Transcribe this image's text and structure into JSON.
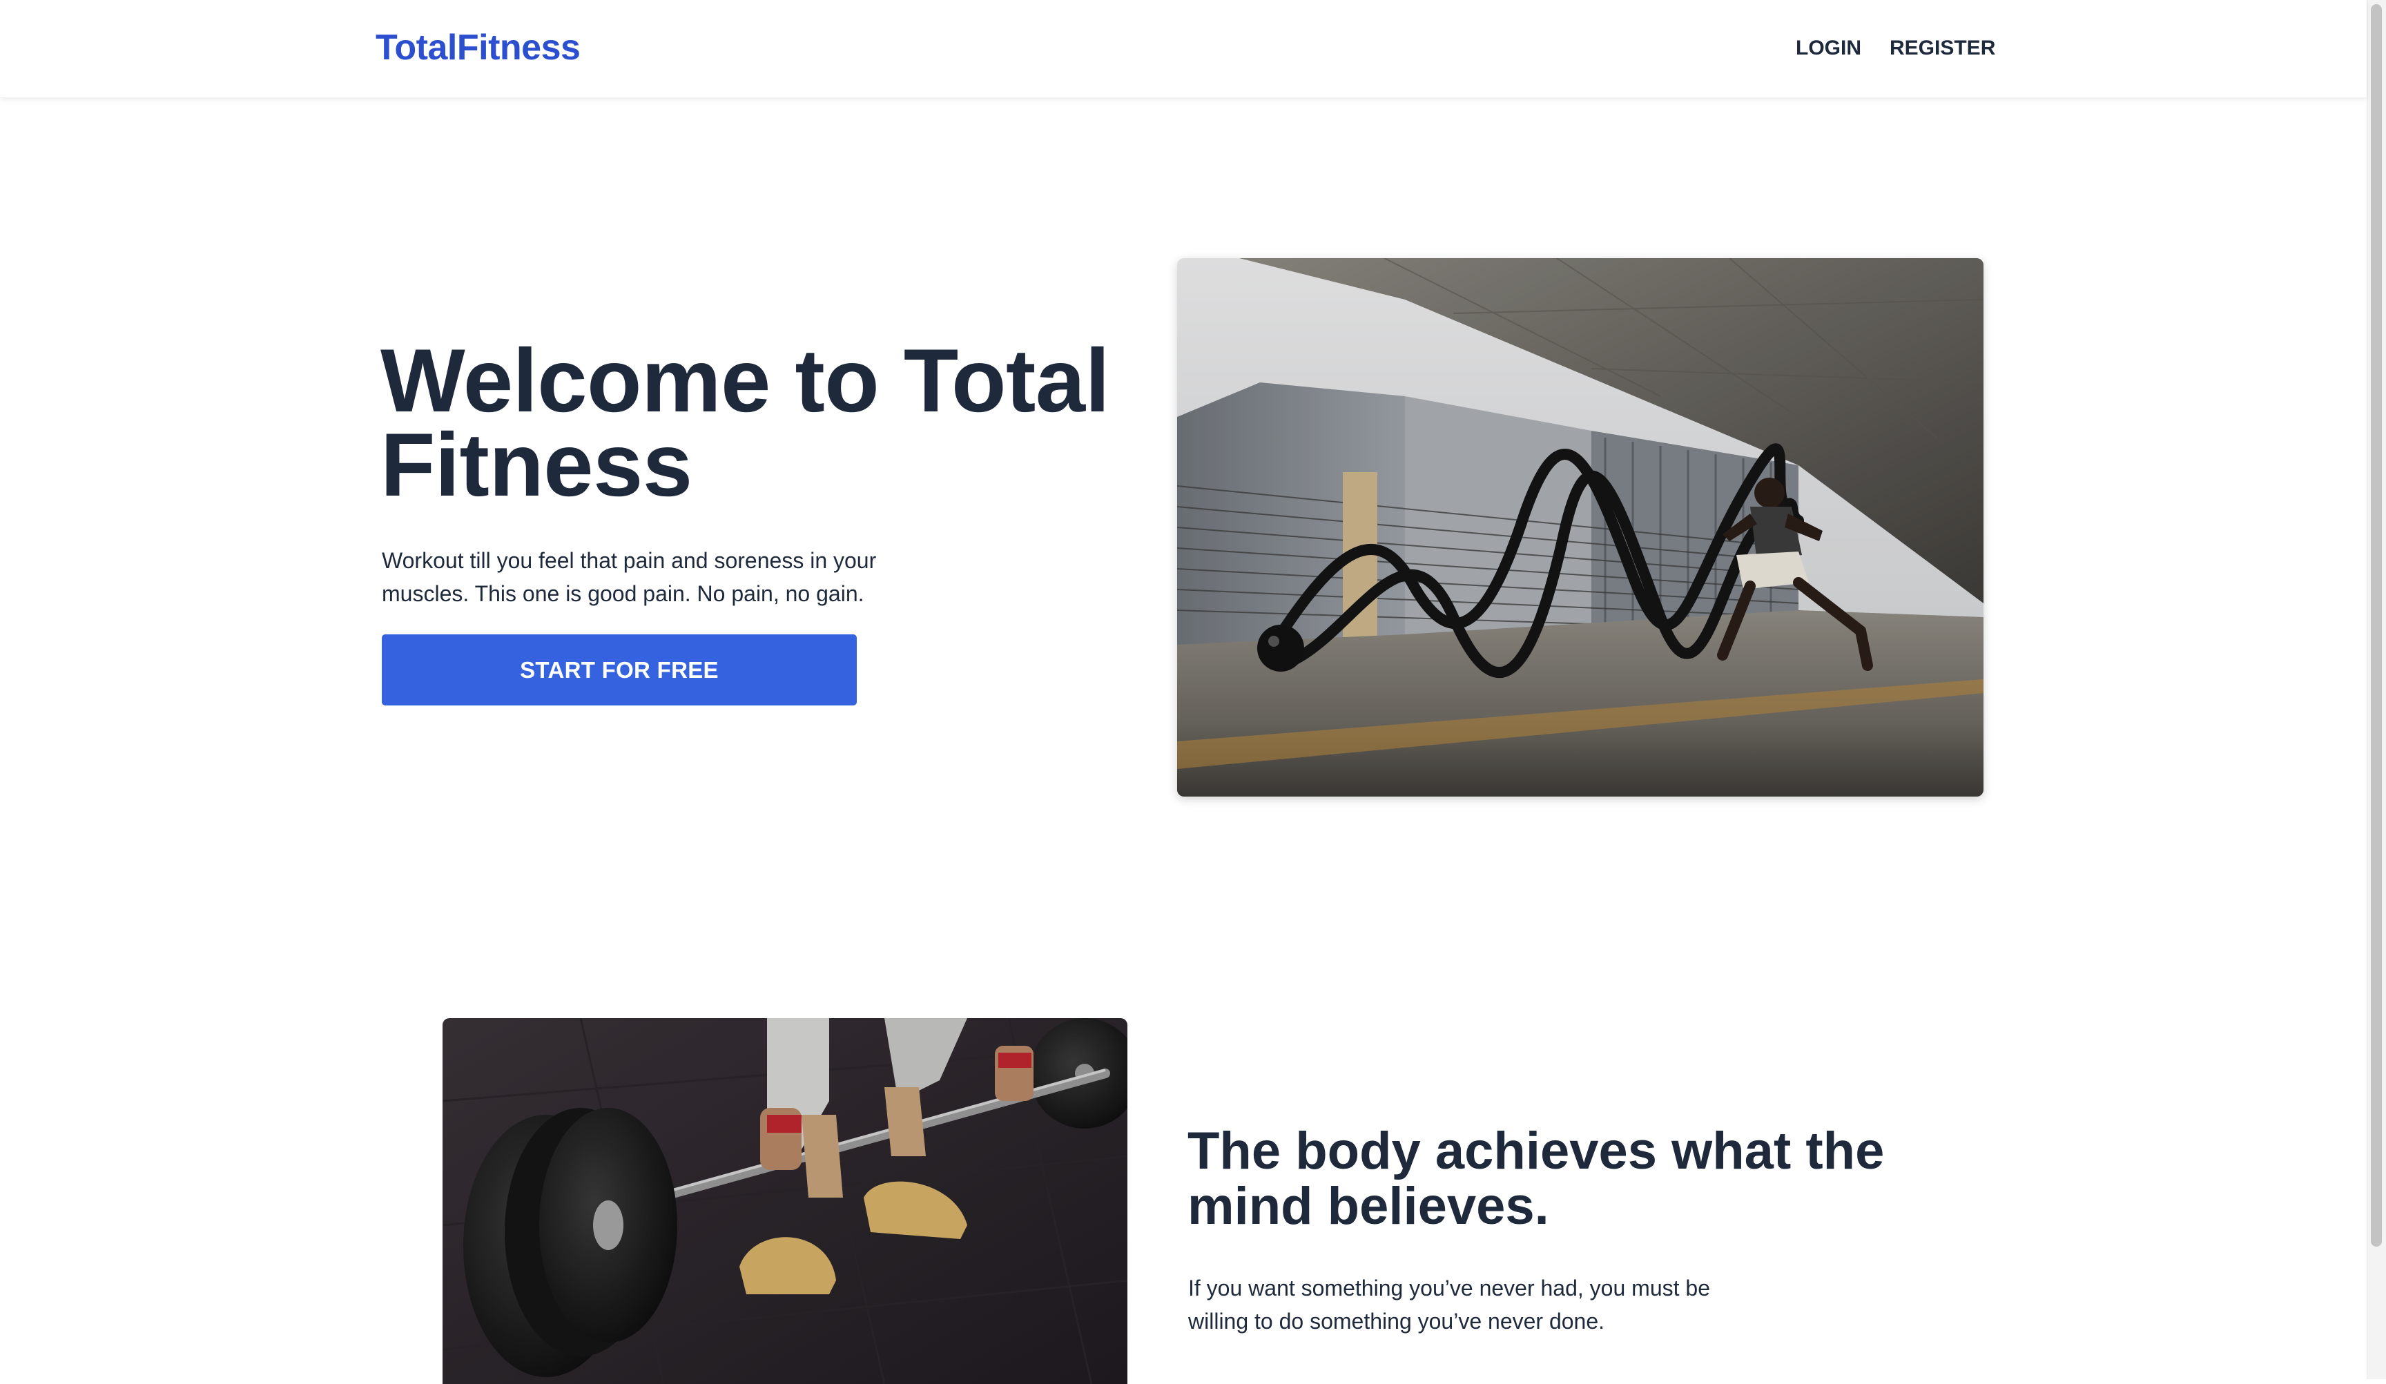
{
  "header": {
    "logo": "TotalFitness",
    "nav": {
      "login": "LOGIN",
      "register": "REGISTER"
    }
  },
  "hero": {
    "title": "Welcome to Total Fitness",
    "description": "Workout till you feel that pain and soreness in your muscles. This one is good pain. No pain, no gain.",
    "cta_label": "START FOR FREE",
    "image": "battle-ropes-workout-photo"
  },
  "feature": {
    "title": "The body achieves what the mind believes.",
    "description": "If you want something you’ve never had, you must be willing to do something you’ve never done.",
    "image": "barbell-deadlift-photo"
  },
  "colors": {
    "brand": "#2c4fcf",
    "button": "#3563e0",
    "text": "#1e293b",
    "background": "#ffffff"
  }
}
